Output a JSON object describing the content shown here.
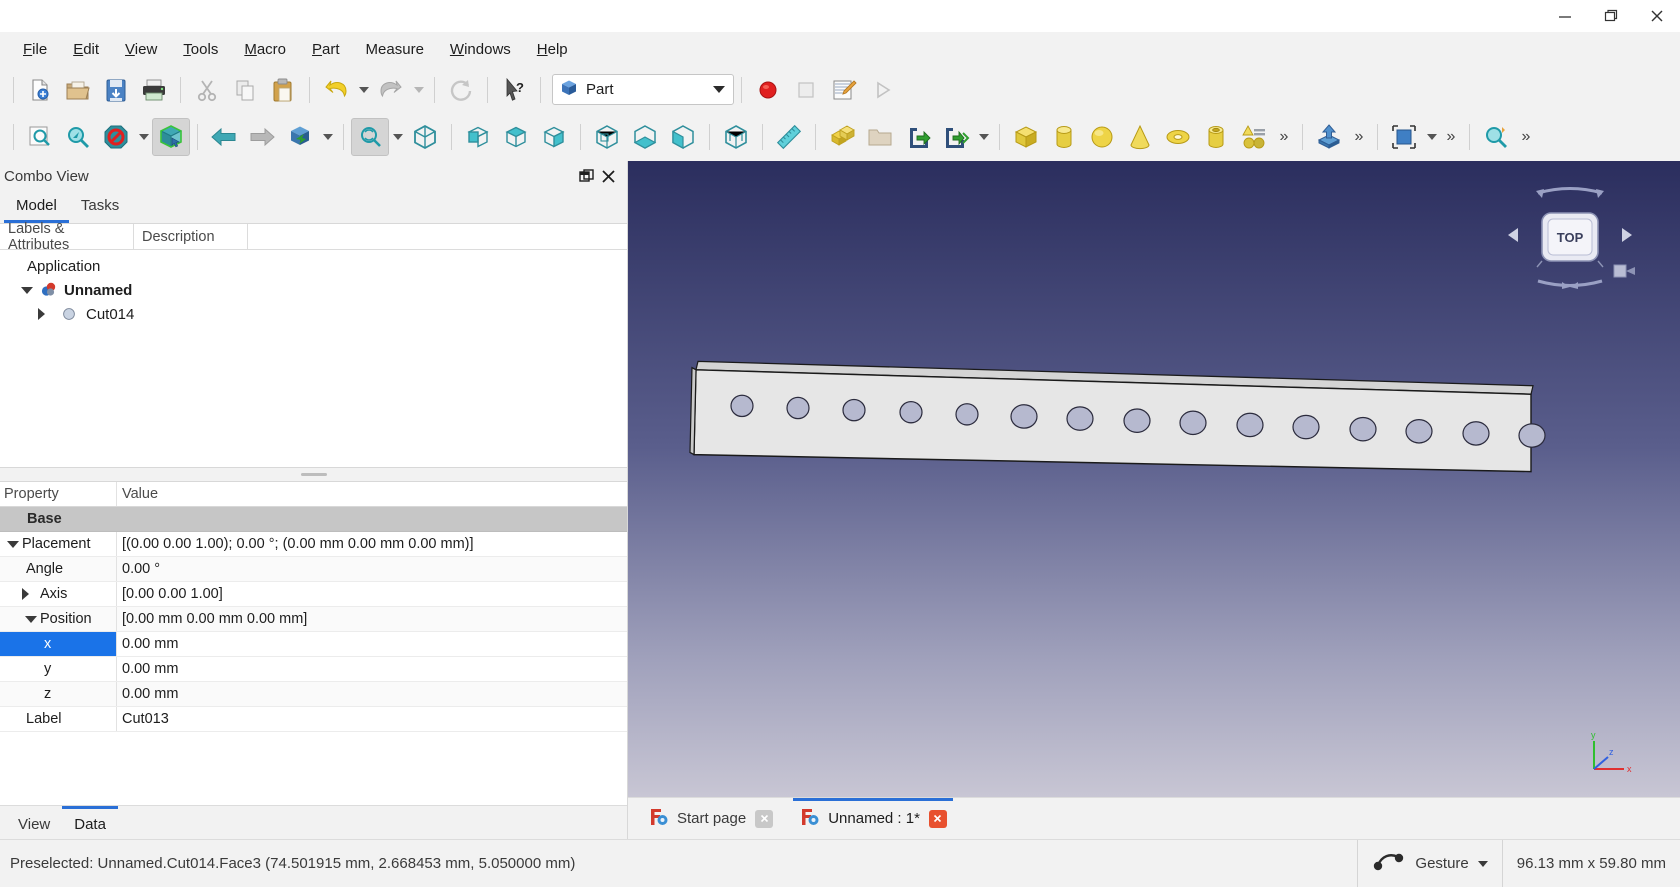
{
  "window": {
    "controls": [
      {
        "name": "minimize-button",
        "glyph": "minimize"
      },
      {
        "name": "maximize-button",
        "glyph": "restore"
      },
      {
        "name": "close-button",
        "glyph": "close"
      }
    ]
  },
  "menubar": {
    "items": [
      {
        "label": "File",
        "mnemonic": "F"
      },
      {
        "label": "Edit",
        "mnemonic": "E"
      },
      {
        "label": "View",
        "mnemonic": "V"
      },
      {
        "label": "Tools",
        "mnemonic": "T"
      },
      {
        "label": "Macro",
        "mnemonic": "M"
      },
      {
        "label": "Part",
        "mnemonic": "P"
      },
      {
        "label": "Measure",
        "mnemonic": ""
      },
      {
        "label": "Windows",
        "mnemonic": "W"
      },
      {
        "label": "Help",
        "mnemonic": "H"
      }
    ]
  },
  "toolbar_file": {
    "buttons": [
      {
        "name": "new-document-icon",
        "title": "New"
      },
      {
        "name": "open-document-icon",
        "title": "Open"
      },
      {
        "name": "save-document-icon",
        "title": "Save"
      },
      {
        "name": "print-icon",
        "title": "Print"
      },
      {
        "name": "cut-icon",
        "title": "Cut"
      },
      {
        "name": "copy-icon",
        "title": "Copy"
      },
      {
        "name": "paste-icon",
        "title": "Paste"
      },
      {
        "name": "undo-icon",
        "title": "Undo"
      },
      {
        "name": "redo-icon",
        "title": "Redo"
      },
      {
        "name": "refresh-icon",
        "title": "Refresh"
      },
      {
        "name": "whats-this-icon",
        "title": "What's This"
      }
    ],
    "workbench": {
      "label": "Part",
      "icon": "part-workbench-icon"
    },
    "macro": [
      {
        "name": "macro-record-icon",
        "title": "Macro recording"
      },
      {
        "name": "macro-stop-icon",
        "title": "Stop macro"
      },
      {
        "name": "macro-edit-icon",
        "title": "Macros"
      },
      {
        "name": "macro-execute-icon",
        "title": "Execute macro"
      }
    ]
  },
  "toolbar_view": {
    "buttons": [
      {
        "name": "fit-all-icon",
        "title": "Fit all"
      },
      {
        "name": "fit-selection-icon",
        "title": "Fit selection"
      },
      {
        "name": "draw-style-icon",
        "title": "Draw style"
      },
      {
        "name": "selection-view-icon",
        "title": "Selection view"
      },
      {
        "name": "back-arrow-icon",
        "title": "Back"
      },
      {
        "name": "forward-arrow-icon",
        "title": "Forward"
      },
      {
        "name": "isometric-view-icon",
        "title": "Axonometric"
      },
      {
        "name": "sync-view-icon",
        "title": "Sync view"
      },
      {
        "name": "fit-cube-icon",
        "title": "Fit cube"
      },
      {
        "name": "front-view-icon",
        "title": "Front"
      },
      {
        "name": "top-view-icon",
        "title": "Top"
      },
      {
        "name": "right-view-icon",
        "title": "Right"
      },
      {
        "name": "rear-view-icon",
        "title": "Rear"
      },
      {
        "name": "bottom-view-icon",
        "title": "Bottom"
      },
      {
        "name": "left-view-icon",
        "title": "Left"
      },
      {
        "name": "wireframe-view-icon",
        "title": "Wireframe"
      },
      {
        "name": "measure-icon",
        "title": "Measure"
      },
      {
        "name": "boolean-icon",
        "title": "Boolean"
      },
      {
        "name": "folder-icon",
        "title": "Compound"
      },
      {
        "name": "export-icon",
        "title": "Export"
      },
      {
        "name": "export-all-icon",
        "title": "Export all"
      },
      {
        "name": "box-primitive-icon",
        "title": "Cube"
      },
      {
        "name": "cylinder-primitive-icon",
        "title": "Cylinder"
      },
      {
        "name": "sphere-primitive-icon",
        "title": "Sphere"
      },
      {
        "name": "cone-primitive-icon",
        "title": "Cone"
      },
      {
        "name": "torus-primitive-icon",
        "title": "Torus"
      },
      {
        "name": "tube-primitive-icon",
        "title": "Tube"
      },
      {
        "name": "shape-builder-icon",
        "title": "Shape builder"
      },
      {
        "name": "extrude-icon",
        "title": "Extrude"
      },
      {
        "name": "bounding-box-icon",
        "title": "Bounding box"
      },
      {
        "name": "zoom-tool-icon",
        "title": "Zoom"
      }
    ]
  },
  "combo_view": {
    "title": "Combo View",
    "float_icon": "undock-icon",
    "close_icon": "close-icon",
    "tabs": [
      {
        "label": "Model",
        "active": true
      },
      {
        "label": "Tasks",
        "active": false
      }
    ],
    "tree_headers": [
      "Labels & Attributes",
      "Description"
    ],
    "tree": [
      {
        "label": "Application",
        "level": 0,
        "twisty": "none",
        "icon": "none",
        "bold": false
      },
      {
        "label": "Unnamed",
        "level": 1,
        "twisty": "down",
        "icon": "document-icon",
        "bold": true
      },
      {
        "label": "Cut014",
        "level": 2,
        "twisty": "right",
        "icon": "cut-feature-icon",
        "bold": false
      }
    ],
    "property_headers": {
      "property": "Property",
      "value": "Value"
    },
    "properties": [
      {
        "name": "Base",
        "value": "",
        "kind": "group",
        "twisty": "none",
        "indent": 0
      },
      {
        "name": "Placement",
        "value": "[(0.00 0.00 1.00); 0.00 °; (0.00 mm  0.00 mm  0.00 mm)]",
        "kind": "row",
        "twisty": "down",
        "indent": 0
      },
      {
        "name": "Angle",
        "value": "0.00 °",
        "kind": "row",
        "twisty": "none",
        "indent": 1
      },
      {
        "name": "Axis",
        "value": "[0.00 0.00 1.00]",
        "kind": "row",
        "twisty": "right",
        "indent": 1
      },
      {
        "name": "Position",
        "value": "[0.00 mm  0.00 mm  0.00 mm]",
        "kind": "row",
        "twisty": "down",
        "indent": 1
      },
      {
        "name": "x",
        "value": "0.00 mm",
        "kind": "row",
        "twisty": "none",
        "indent": 2,
        "selected": true
      },
      {
        "name": "y",
        "value": "0.00 mm",
        "kind": "row",
        "twisty": "none",
        "indent": 2
      },
      {
        "name": "z",
        "value": "0.00 mm",
        "kind": "row",
        "twisty": "none",
        "indent": 2
      },
      {
        "name": "Label",
        "value": "Cut013",
        "kind": "row",
        "twisty": "none",
        "indent": 0
      }
    ],
    "bottom_tabs": [
      {
        "label": "View",
        "active": false
      },
      {
        "label": "Data",
        "active": true
      }
    ]
  },
  "view3d": {
    "navcube_label": "TOP",
    "axis_labels": {
      "x": "x",
      "y": "y",
      "z": "z"
    },
    "model": {
      "name": "perforated-bar",
      "hole_count": 15,
      "face_color": "#e6e6e6",
      "edge_color": "#1a1a1a",
      "hole_fill": "#b6b9cf"
    }
  },
  "mdi_tabs": [
    {
      "label": "Start page",
      "active": false,
      "icon": "freecad-icon",
      "close": "close-icon",
      "close_style": "gray"
    },
    {
      "label": "Unnamed : 1*",
      "active": true,
      "icon": "freecad-icon",
      "close": "close-icon",
      "close_style": "red"
    }
  ],
  "statusbar": {
    "message": "Preselected: Unnamed.Cut014.Face3 (74.501915 mm, 2.668453 mm, 5.050000 mm)",
    "navigation_icon": "gesture-icon",
    "navigation_label": "Gesture",
    "dimensions": "96.13 mm x 59.80 mm"
  },
  "colors": {
    "accent": "#2a6fd6",
    "selection": "#1a73e8",
    "group_row": "#c6c6c6",
    "toolbar_bg": "#f2f2f2",
    "view_top": "#2b2e5e",
    "view_bottom": "#c8c6d4"
  }
}
